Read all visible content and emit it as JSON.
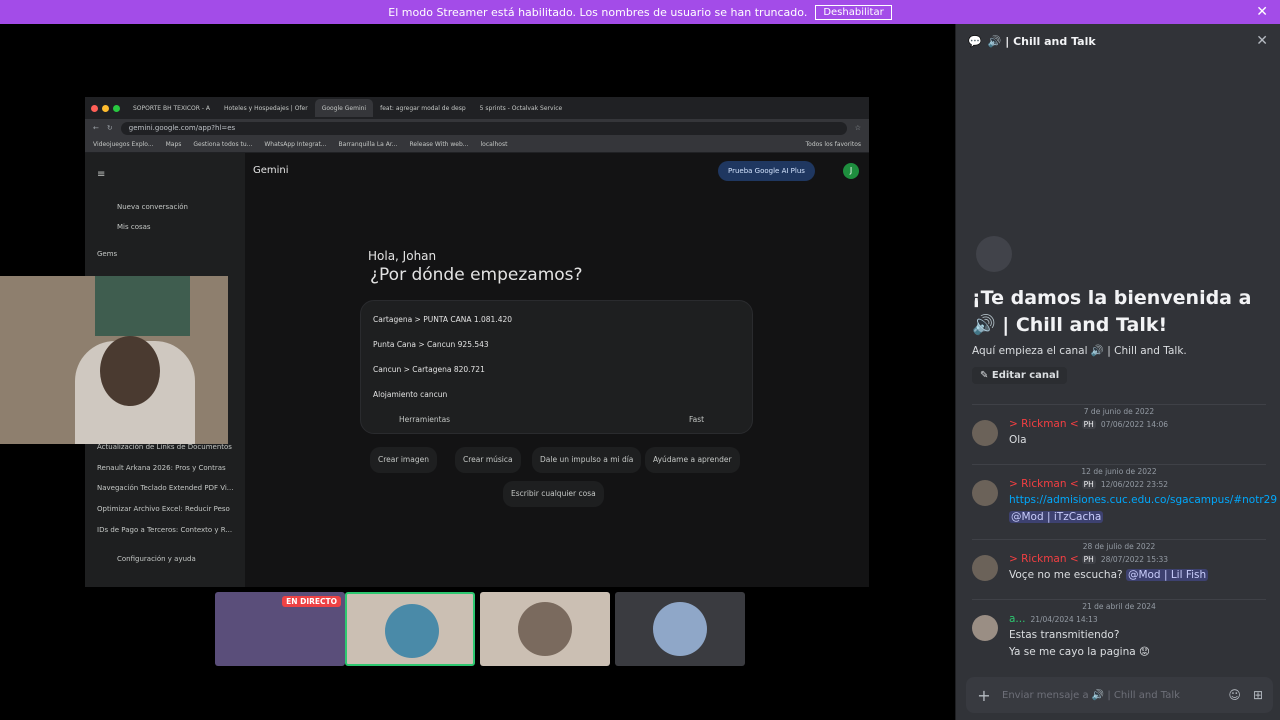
{
  "banner": {
    "text": "El modo Streamer está habilitado. Los nombres de usuario se han truncado.",
    "button": "Deshabilitar"
  },
  "browser": {
    "tabs": [
      "SOPORTE BH TEXICOR - A",
      "Hoteles y Hospedajes | Ofer",
      "Google Gemini",
      "feat: agregar modal de desp",
      "5 sprints - Octalvak Service"
    ],
    "url": "gemini.google.com/app?hl=es",
    "bookmarks": [
      "Videojuegos Explo...",
      "Maps",
      "Gestiona todos tu...",
      "WhatsApp Integrat...",
      "Barranquilla La Ar...",
      "Release With web...",
      "localhost",
      "Todos los favoritos"
    ],
    "sidebar": {
      "new_chat": "Nueva conversación",
      "my_stuff": "Mis cosas",
      "gems": "Gems",
      "recents": [
        "Actualización de Links de Documentos",
        "Renault Arkana 2026: Pros y Contras",
        "Navegación Teclado Extended PDF Vi...",
        "Optimizar Archivo Excel: Reducir Peso",
        "IDs de Pago a Terceros: Contexto y R..."
      ],
      "settings": "Configuración y ayuda"
    },
    "main": {
      "title": "Gemini",
      "plus_button": "Prueba Google AI Plus",
      "avatar": "J",
      "greeting": "Hola, Johan",
      "question": "¿Por dónde empezamos?",
      "prompt_lines": [
        "Cartagena > PUNTA CANA 1.081.420",
        "Punta Cana > Cancun 925.543",
        "Cancun > Cartagena 820.721",
        "Alojamiento cancun"
      ],
      "tools_label": "Herramientas",
      "mode": "Fast",
      "chips": [
        "Crear imagen",
        "Crear música",
        "Dale un impulso a mi día",
        "Ayúdame a aprender",
        "Escribir cualquier cosa"
      ]
    }
  },
  "tiles": {
    "live_badge": "EN DIRECTO"
  },
  "panel": {
    "header_title": "🔊 | Chill and Talk",
    "welcome_title": "¡Te damos la bienvenida a 🔊 | Chill and Talk!",
    "welcome_sub": "Aquí empieza el canal 🔊 | Chill and Talk.",
    "edit_button": "Editar canal",
    "dates": [
      "7 de junio de 2022",
      "12 de junio de 2022",
      "28 de julio de 2022",
      "21 de abril de 2024"
    ],
    "messages": [
      {
        "author": "> Rickman <",
        "tag": "PH",
        "time": "07/06/2022 14:06",
        "lines": [
          "Ola"
        ]
      },
      {
        "author": "> Rickman <",
        "tag": "PH",
        "time": "12/06/2022 23:52",
        "link": "https://admisiones.cuc.edu.co/sgacampus/#notr29",
        "mention": "@Mod | iTzCacha"
      },
      {
        "author": "> Rickman <",
        "tag": "PH",
        "time": "28/07/2022 15:33",
        "text": "Voçe no me escucha?",
        "mention": "@Mod | Lil Fish"
      },
      {
        "author": "a...",
        "time": "21/04/2024 14:13",
        "lines": [
          "Estas transmitiendo?",
          "Ya se me cayo la pagina 😟"
        ]
      }
    ],
    "composer_placeholder": "Enviar mensaje a 🔊 | Chill and Talk"
  },
  "colors": {
    "banner": "#a34ce8",
    "panel_bg": "#313338",
    "name_red": "#f23f42",
    "link": "#00a8fc"
  }
}
